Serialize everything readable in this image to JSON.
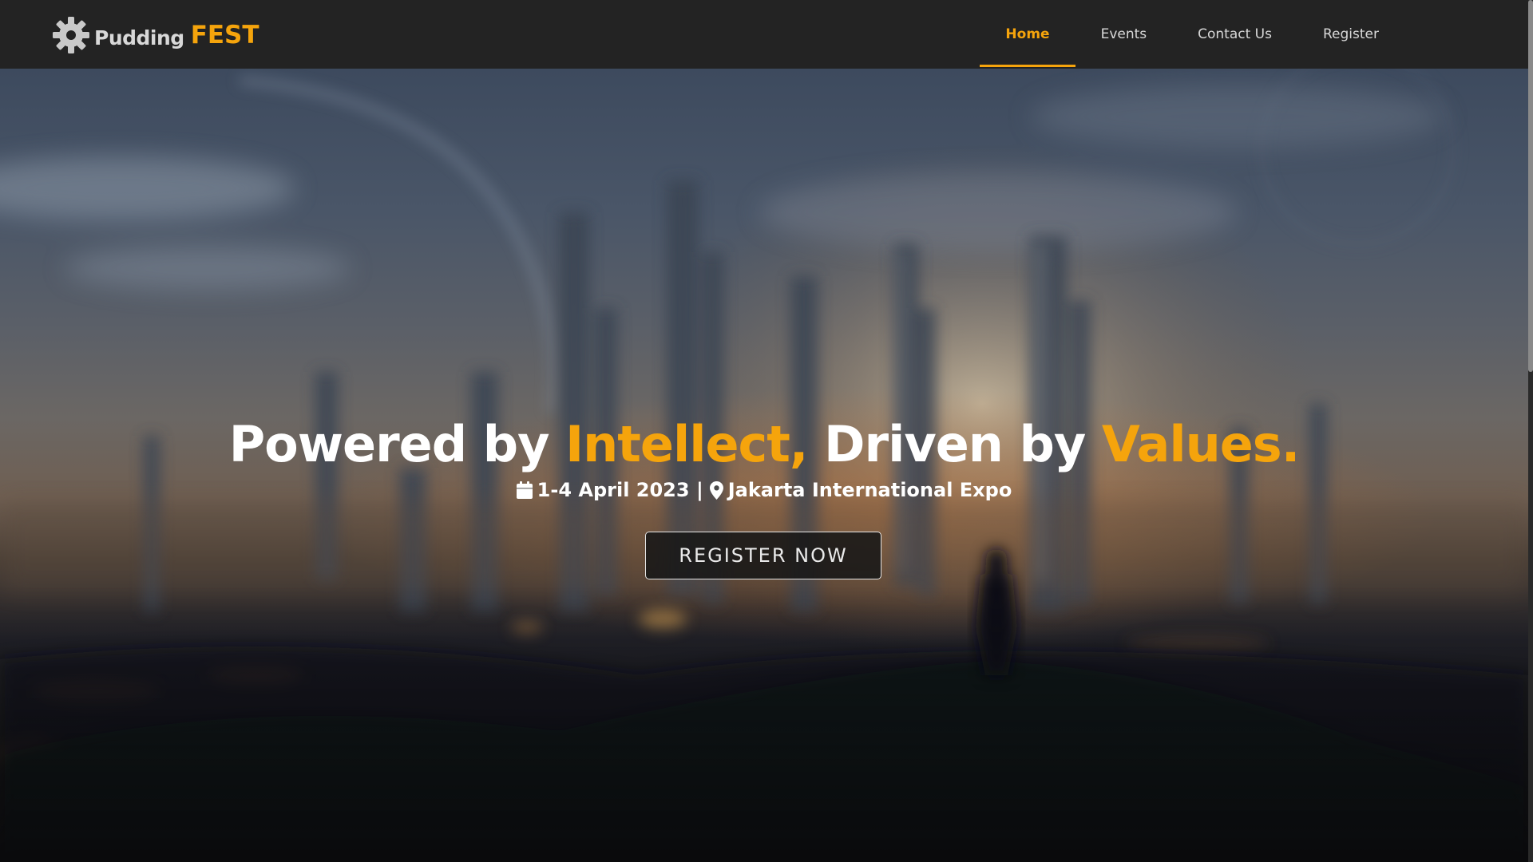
{
  "brand": {
    "name_part1": "Pudding",
    "name_part2": "FEST",
    "logo_icon": "gear-icon",
    "accent_color": "#f5a40c"
  },
  "nav": {
    "items": [
      {
        "label": "Home",
        "active": true
      },
      {
        "label": "Events",
        "active": false
      },
      {
        "label": "Contact Us",
        "active": false
      },
      {
        "label": "Register",
        "active": false
      }
    ]
  },
  "hero": {
    "title_part1": "Powered by ",
    "title_accent1": "Intellect,",
    "title_part2": " Driven by ",
    "title_accent2": "Values.",
    "date_icon": "calendar-icon",
    "date_text": "1-4 April 2023 |",
    "location_icon": "map-pin-icon",
    "location_text": "Jakarta International Expo",
    "cta_label": "REGISTER NOW"
  }
}
